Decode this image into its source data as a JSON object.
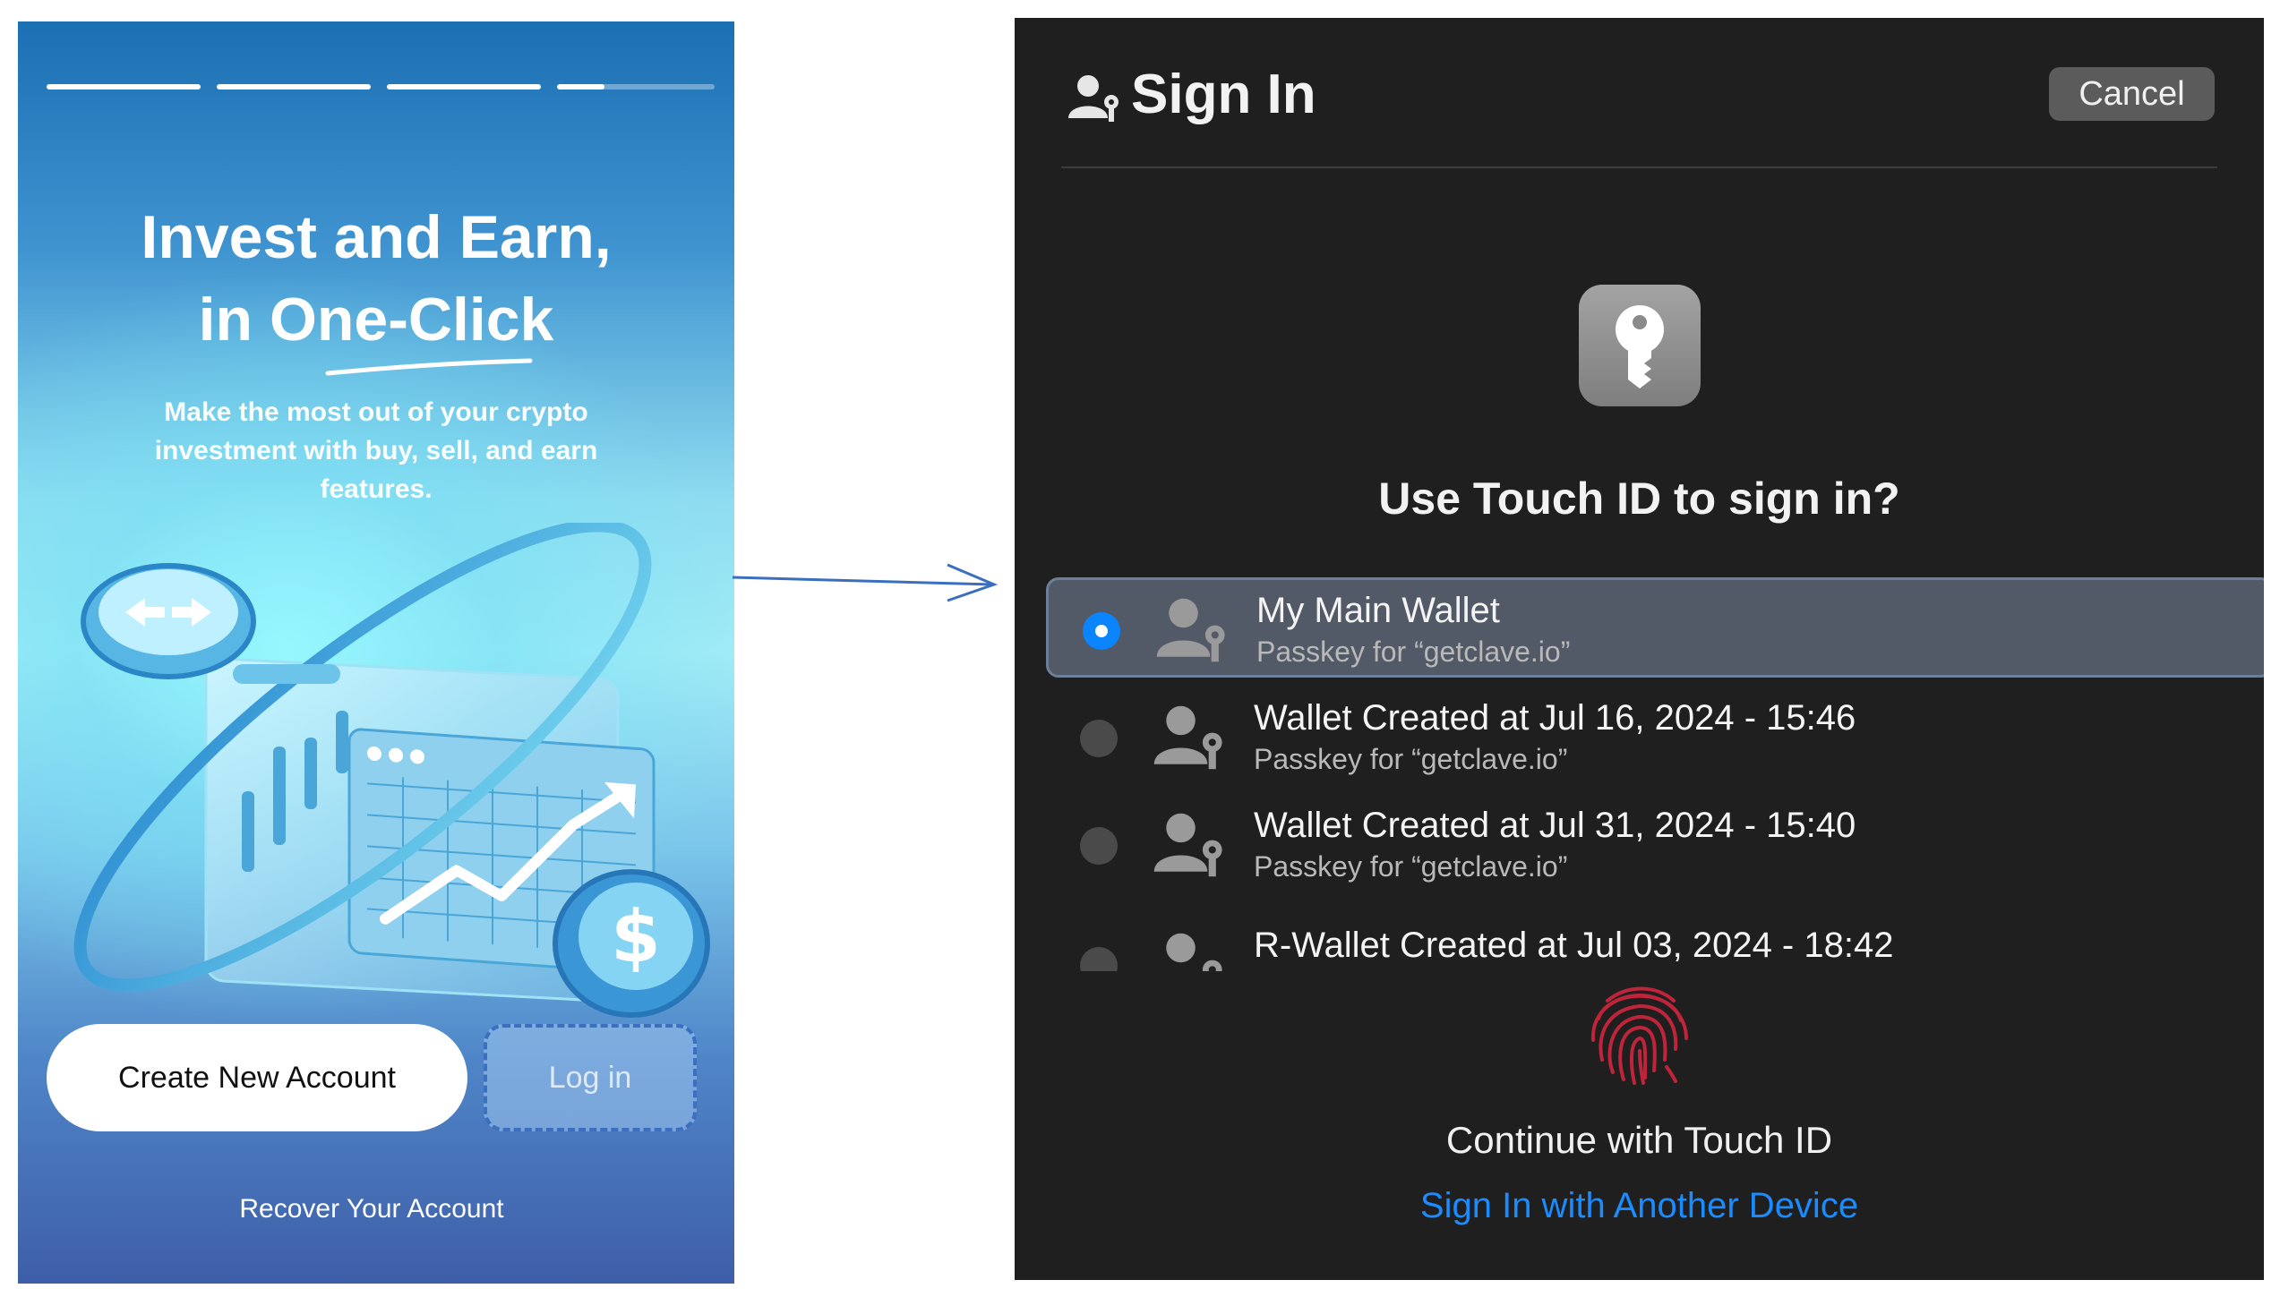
{
  "onboarding": {
    "progress": [
      1,
      1,
      1,
      0.3
    ],
    "headline_line1": "Invest and Earn,",
    "headline_line2": "in One-Click",
    "subtitle": "Make the most out of your crypto investment with buy, sell, and earn features.",
    "create_button": "Create New Account",
    "login_button": "Log in",
    "recover_link": "Recover Your Account"
  },
  "sign_in": {
    "header_icon": "person-key-icon",
    "title": "Sign In",
    "cancel_label": "Cancel",
    "key_icon": "passkey-key-icon",
    "question": "Use Touch ID to sign in?",
    "accounts": [
      {
        "name": "My Main Wallet",
        "subtitle": "Passkey for “getclave.io”",
        "selected": true
      },
      {
        "name": "Wallet Created at Jul 16, 2024 - 15:46",
        "subtitle": "Passkey for “getclave.io”",
        "selected": false
      },
      {
        "name": "Wallet Created at Jul 31, 2024 - 15:40",
        "subtitle": "Passkey for “getclave.io”",
        "selected": false
      },
      {
        "name": "R-Wallet Created at Jul 03, 2024 - 18:42",
        "subtitle": "",
        "selected": false
      }
    ],
    "fingerprint_icon": "fingerprint-icon",
    "continue_text": "Continue with Touch ID",
    "other_device_link": "Sign In with Another Device"
  },
  "colors": {
    "accent_blue": "#0a84ff",
    "link_blue": "#1a8cff",
    "fingerprint_red": "#c0243a",
    "sheet_bg": "#1f1f1f"
  }
}
